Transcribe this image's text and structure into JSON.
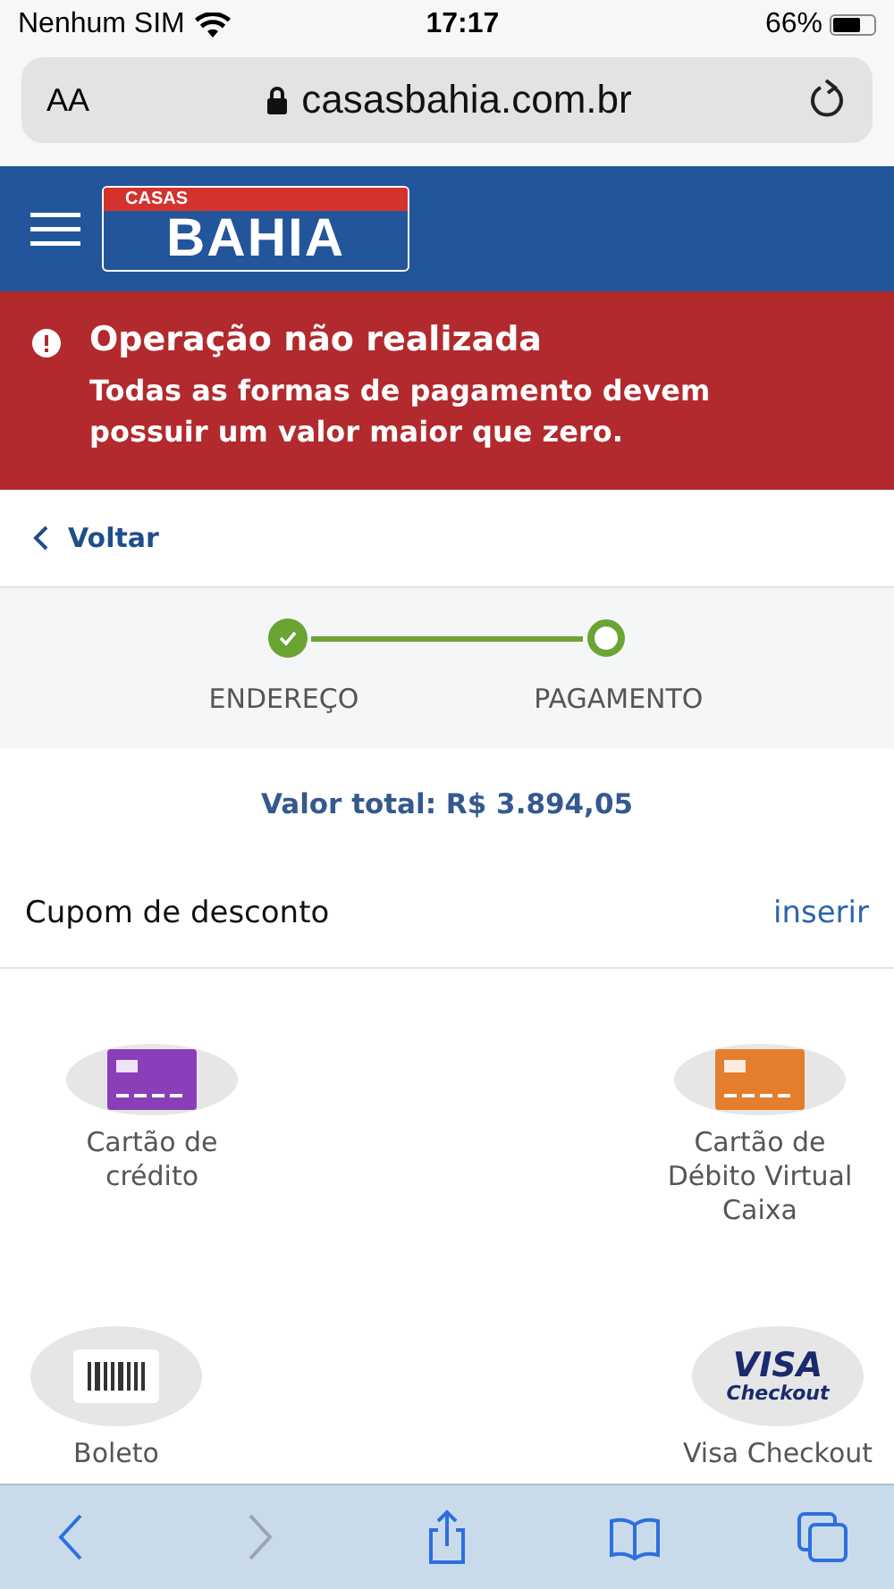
{
  "status_bar": {
    "carrier": "Nenhum SIM",
    "time": "17:17",
    "battery": "66%"
  },
  "browser": {
    "text_size": "AA",
    "url": "casasbahia.com.br"
  },
  "header": {
    "logo_top": "CASAS",
    "logo_main": "BAHIA"
  },
  "alert": {
    "title": "Operação não realizada",
    "message": "Todas as formas de pagamento devem possuir um valor maior que zero."
  },
  "back_link": "Voltar",
  "steps": [
    {
      "label": "ENDEREÇO",
      "done": true
    },
    {
      "label": "PAGAMENTO",
      "done": false
    }
  ],
  "total": "Valor total: R$ 3.894,05",
  "coupon": {
    "label": "Cupom de desconto",
    "action": "inserir"
  },
  "payment_methods": [
    {
      "kind": "card",
      "color": "#8a3fb8",
      "label": "Cartão de crédito"
    },
    {
      "kind": "card",
      "color": "#e47e2c",
      "label": "Cartão de Débito Virtual Caixa"
    },
    {
      "kind": "barcode",
      "label": "Boleto"
    },
    {
      "kind": "visa",
      "label": "Visa Checkout",
      "logo_top": "VISA",
      "logo_bottom": "Checkout"
    }
  ],
  "toolbar": [
    {
      "kind": "back",
      "disabled": false
    },
    {
      "kind": "forward",
      "disabled": true
    },
    {
      "kind": "share",
      "disabled": false
    },
    {
      "kind": "bookmarks",
      "disabled": false
    },
    {
      "kind": "tabs",
      "disabled": false
    }
  ]
}
